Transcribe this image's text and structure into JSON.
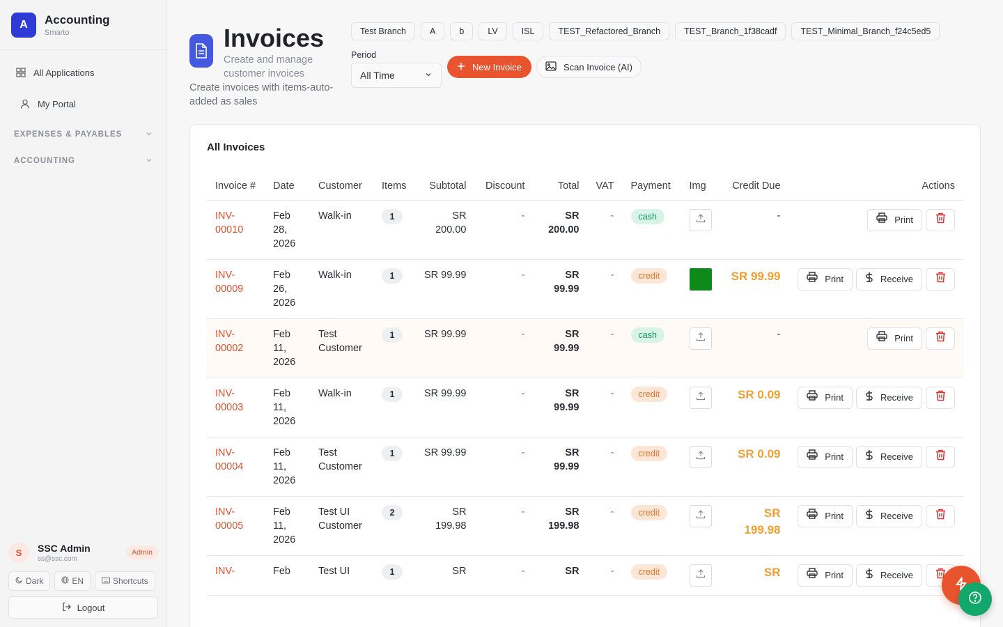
{
  "app": {
    "logo_letter": "A",
    "title": "Accounting",
    "subtitle": "Smarto"
  },
  "nav": {
    "all_apps": "All Applications",
    "my_portal": "My Portal",
    "sections": [
      "EXPENSES & PAYABLES",
      "ACCOUNTING"
    ]
  },
  "user": {
    "initial": "S",
    "name": "SSC Admin",
    "email": "ss@ssc.com",
    "role": "Admin"
  },
  "footer": {
    "dark": "Dark",
    "lang": "EN",
    "shortcuts": "Shortcuts",
    "logout": "Logout"
  },
  "page": {
    "title": "Invoices",
    "subtitle": "Create and manage customer invoices",
    "description": "Create invoices with items-auto-added as sales"
  },
  "branches": [
    "Test Branch",
    "A",
    "b",
    "LV",
    "ISL",
    "TEST_Refactored_Branch",
    "TEST_Branch_1f38cadf",
    "TEST_Minimal_Branch_f24c5ed5"
  ],
  "period": {
    "label": "Period",
    "value": "All Time"
  },
  "buttons": {
    "new_invoice": "New Invoice",
    "scan_invoice": "Scan Invoice (AI)",
    "print": "Print",
    "receive": "Receive"
  },
  "table": {
    "title": "All Invoices",
    "headers": [
      "Invoice #",
      "Date",
      "Customer",
      "Items",
      "Subtotal",
      "Discount",
      "Total",
      "VAT",
      "Payment",
      "Img",
      "Credit Due",
      "Actions"
    ],
    "rows": [
      {
        "invoice": "INV-00010",
        "date": "Feb 28, 2026",
        "customer": "Walk-in",
        "items": "1",
        "subtotal": "SR 200.00",
        "discount": "-",
        "total": "SR 200.00",
        "vat": "-",
        "payment": "cash",
        "img": "upload",
        "credit_due": "-"
      },
      {
        "invoice": "INV-00009",
        "date": "Feb 26, 2026",
        "customer": "Walk-in",
        "items": "1",
        "subtotal": "SR 99.99",
        "discount": "-",
        "total": "SR 99.99",
        "vat": "-",
        "payment": "credit",
        "img": "thumbnail",
        "credit_due": "SR 99.99"
      },
      {
        "invoice": "INV-00002",
        "date": "Feb 11, 2026",
        "customer": "Test Customer",
        "items": "1",
        "subtotal": "SR 99.99",
        "discount": "-",
        "total": "SR 99.99",
        "vat": "-",
        "payment": "cash",
        "img": "upload",
        "credit_due": "-"
      },
      {
        "invoice": "INV-00003",
        "date": "Feb 11, 2026",
        "customer": "Walk-in",
        "items": "1",
        "subtotal": "SR 99.99",
        "discount": "-",
        "total": "SR 99.99",
        "vat": "-",
        "payment": "credit",
        "img": "upload",
        "credit_due": "SR 0.09"
      },
      {
        "invoice": "INV-00004",
        "date": "Feb 11, 2026",
        "customer": "Test Customer",
        "items": "1",
        "subtotal": "SR 99.99",
        "discount": "-",
        "total": "SR 99.99",
        "vat": "-",
        "payment": "credit",
        "img": "upload",
        "credit_due": "SR 0.09"
      },
      {
        "invoice": "INV-00005",
        "date": "Feb 11, 2026",
        "customer": "Test UI Customer",
        "items": "2",
        "subtotal": "SR 199.98",
        "discount": "-",
        "total": "SR 199.98",
        "vat": "-",
        "payment": "credit",
        "img": "upload",
        "credit_due": "SR 199.98"
      },
      {
        "invoice": "INV-",
        "date": "Feb",
        "customer": "Test UI",
        "items": "1",
        "subtotal": "SR",
        "discount": "-",
        "total": "SR",
        "vat": "-",
        "payment": "credit",
        "img": "upload",
        "credit_due": "SR"
      }
    ]
  },
  "icons": {
    "fab": "bolt-icon",
    "help": "help-icon"
  },
  "colors": {
    "accent": "#e8542e",
    "brand": "#2f3bd6",
    "success": "#12a86b",
    "credit_due": "#f0a030"
  }
}
